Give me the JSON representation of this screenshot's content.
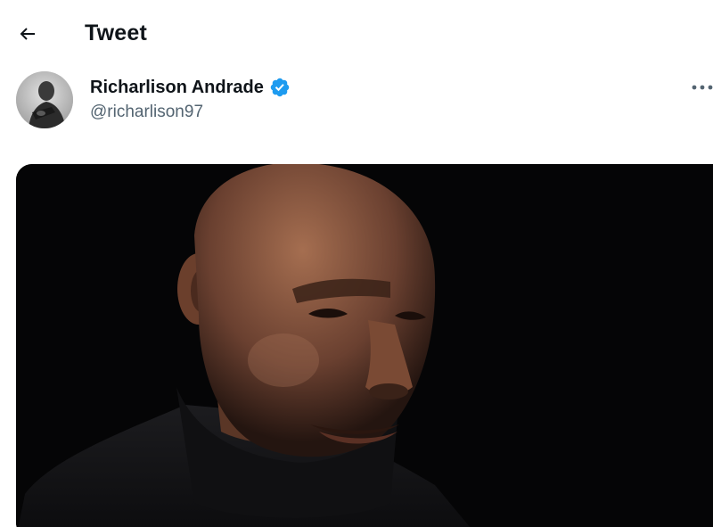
{
  "header": {
    "title": "Tweet",
    "back_icon": "arrow-left-icon"
  },
  "tweet": {
    "author": {
      "display_name": "Richarlison Andrade",
      "handle": "@richarlison97",
      "verified": true,
      "verified_icon": "verified-badge-icon",
      "verified_color": "#1d9bf0"
    },
    "more_icon": "more-horizontal-icon",
    "media_type": "image"
  },
  "colors": {
    "text_primary": "#0f1419",
    "text_secondary": "#536471",
    "accent": "#1d9bf0",
    "background": "#ffffff"
  }
}
